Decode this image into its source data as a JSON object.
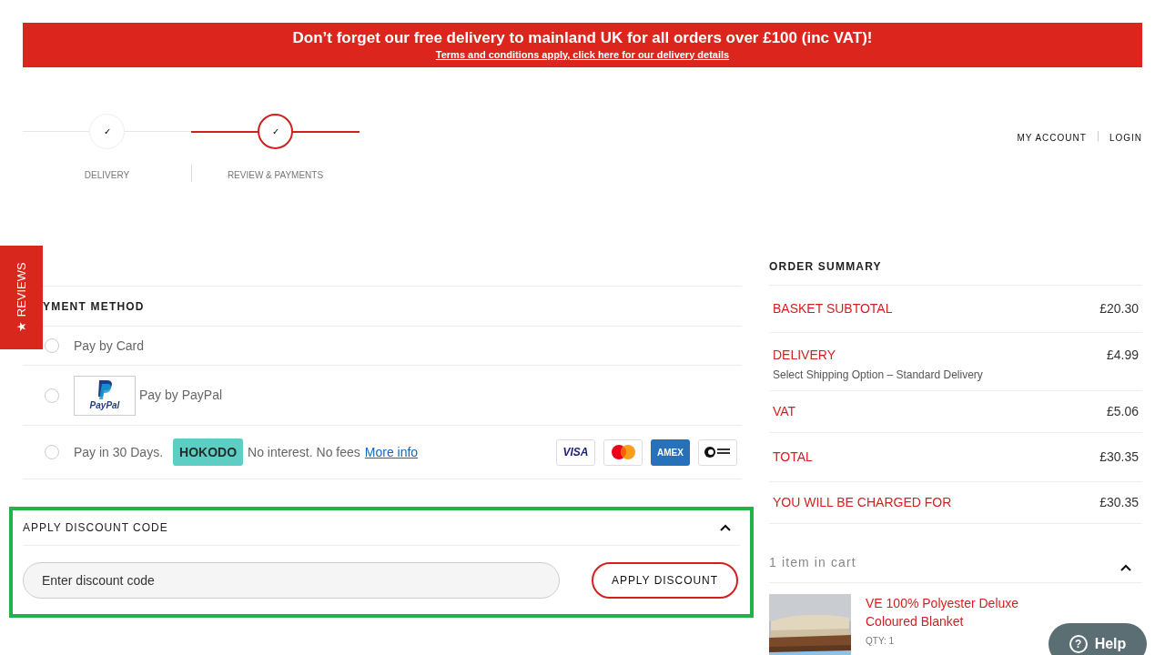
{
  "banner": {
    "headline": "Don’t forget our free delivery to mainland UK for all orders over £100 (inc VAT)!",
    "link": "Terms and conditions apply, click here for our delivery details"
  },
  "steps": [
    {
      "label": "DELIVERY",
      "selected": false,
      "mark": "✓"
    },
    {
      "label": "REVIEW & PAYMENTS",
      "selected": true,
      "mark": "✓"
    }
  ],
  "account_links": [
    "MY ACCOUNT",
    "LOGIN"
  ],
  "reviews_tab": {
    "star": "★",
    "label": "REVIEWS"
  },
  "payment": {
    "title": "YMENT METHOD",
    "methods": [
      {
        "kind": "card",
        "label": "Pay by Card",
        "selected": false
      },
      {
        "kind": "paypal",
        "label": "Pay by PayPal",
        "logo_text": "PayPal",
        "selected": false
      },
      {
        "kind": "hokodo",
        "label": "Pay in 30 Days.",
        "badge": "HOKODO",
        "note": "No interest. No fees",
        "link": "More info",
        "selected": false
      }
    ],
    "cards": [
      {
        "kind": "visa",
        "label": "VISA"
      },
      {
        "kind": "mastercard"
      },
      {
        "kind": "amex",
        "label": "AMEX"
      },
      {
        "kind": "directdebit"
      }
    ]
  },
  "discount": {
    "title": "APPLY DISCOUNT CODE",
    "expanded": true,
    "placeholder": "Enter discount code",
    "button": "APPLY DISCOUNT"
  },
  "order_summary": {
    "title": "ORDER SUMMARY",
    "rows": [
      {
        "label": "BASKET SUBTOTAL",
        "value": "£20.30"
      },
      {
        "label": "DELIVERY",
        "note": "Select Shipping Option – Standard Delivery",
        "value": "£4.99"
      },
      {
        "label": "VAT",
        "value": "£5.06"
      },
      {
        "label": "TOTAL",
        "value": "£30.35"
      },
      {
        "label": "YOU WILL BE CHARGED FOR",
        "value": "£30.35"
      }
    ],
    "cart_count": "1 item in cart",
    "cart_expanded": true,
    "items": [
      {
        "kind": "picture",
        "name": "VE 100% Polyester Deluxe Coloured Blanket",
        "qty": "QTY: 1"
      }
    ]
  },
  "help_button": {
    "icon": "?",
    "label": "Help"
  }
}
